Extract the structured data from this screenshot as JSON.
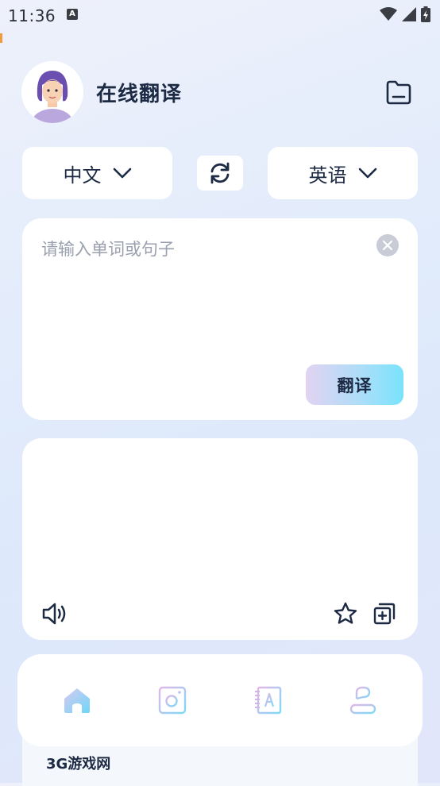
{
  "status_bar": {
    "time": "11:36",
    "notification_icon_letter": "A",
    "icons": [
      "wifi-icon",
      "signal-icon",
      "battery-charging-icon"
    ]
  },
  "header": {
    "title": "在线翻译",
    "avatar_icon": "user-avatar",
    "folder_icon": "folder-icon"
  },
  "languages": {
    "source": "中文",
    "target": "英语",
    "swap_icon": "swap-icon",
    "dropdown_icon": "chevron-down-icon"
  },
  "input": {
    "placeholder": "请输入单词或句子",
    "value": "",
    "clear_icon": "clear-icon",
    "translate_label": "翻译"
  },
  "output": {
    "text": "",
    "actions": [
      "speaker-icon",
      "star-icon",
      "copy-icon"
    ]
  },
  "bottom_nav": {
    "items": [
      {
        "name": "home",
        "icon": "home-icon",
        "active": true
      },
      {
        "name": "camera",
        "icon": "camera-icon",
        "active": false
      },
      {
        "name": "dictionary",
        "icon": "dictionary-icon",
        "active": false
      },
      {
        "name": "profile",
        "icon": "profile-icon",
        "active": false
      }
    ]
  },
  "footer_peek": {
    "text": "3G游戏网"
  },
  "colors": {
    "text_dark": "#1d2a44",
    "placeholder": "#9aa0ad",
    "accent_gradient_start": "#e2d3f2",
    "accent_gradient_end": "#79e3fb",
    "card": "#ffffff"
  }
}
